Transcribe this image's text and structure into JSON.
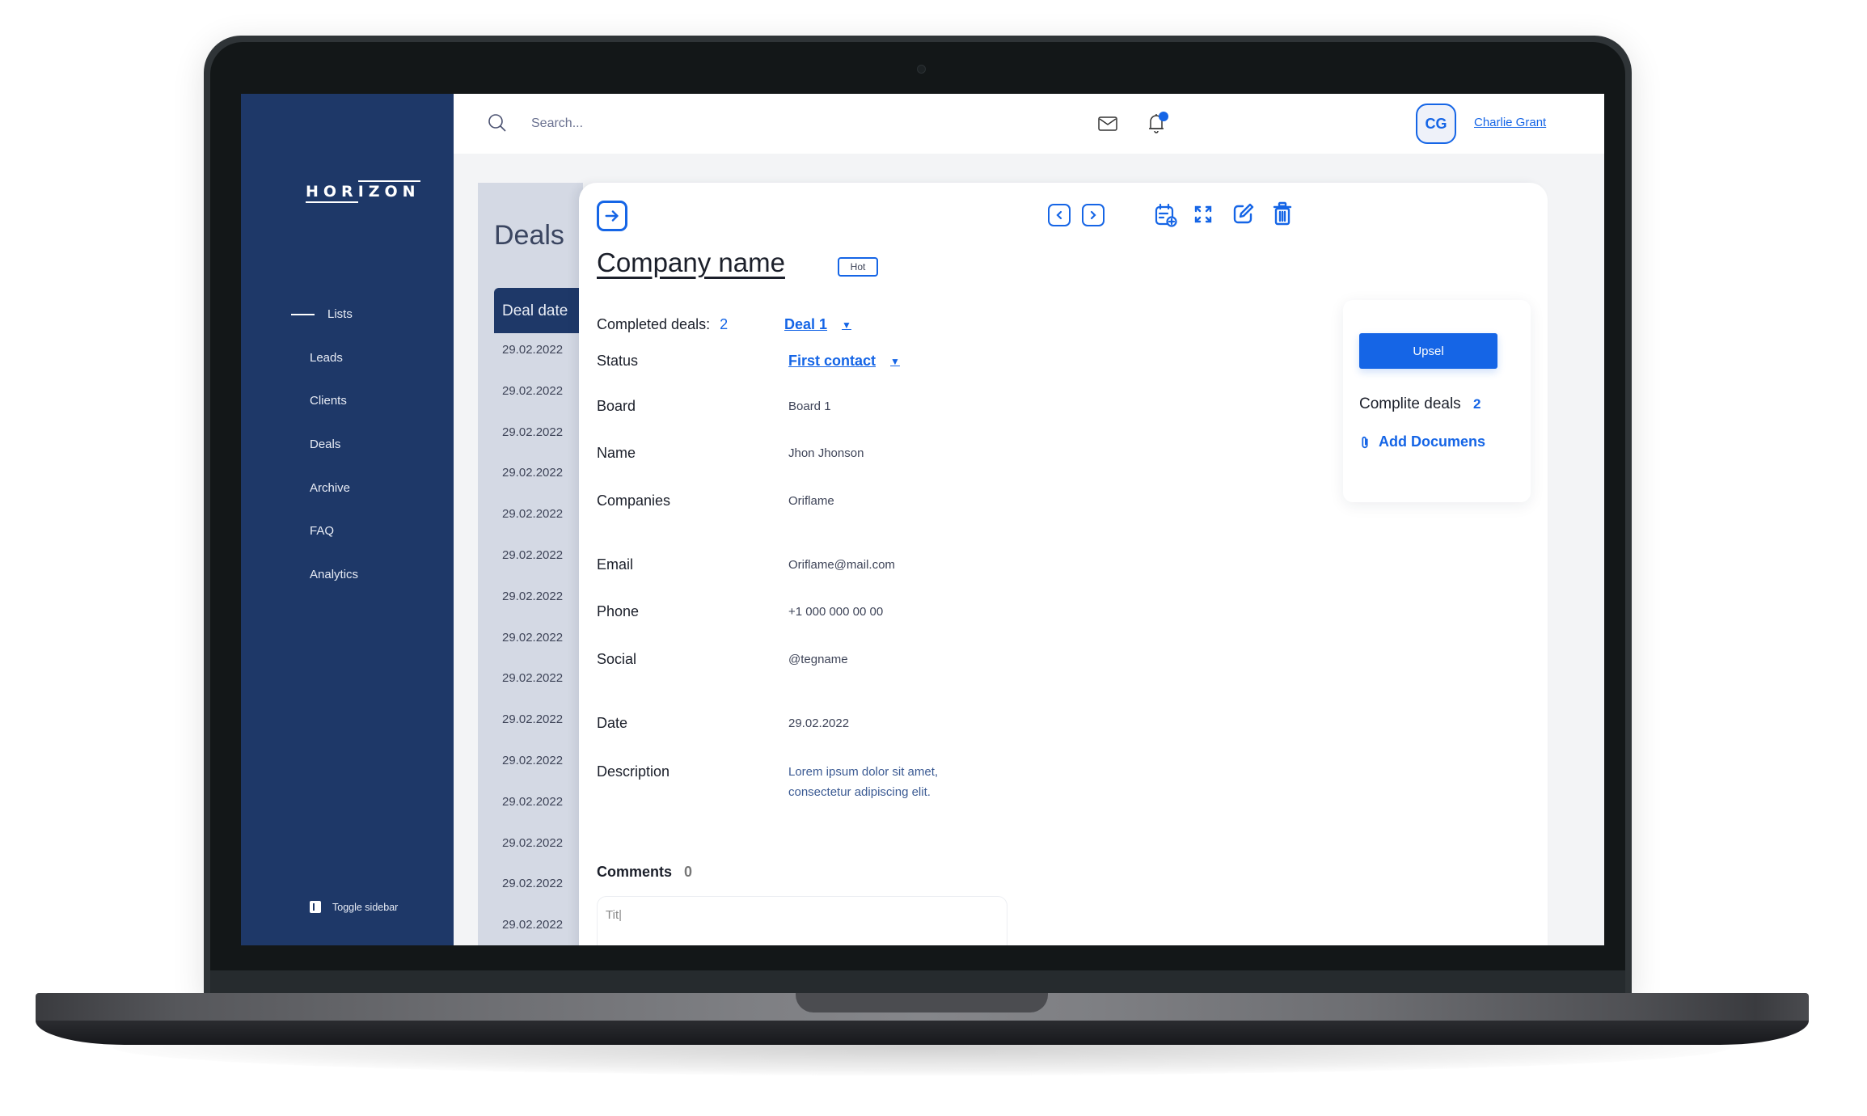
{
  "app": {
    "brand": {
      "logo_text": "HORIZON"
    },
    "colors": {
      "sidebar": "#1e3868",
      "accent": "#1565e6",
      "panel_bg": "#f3f4f6"
    }
  },
  "sidebar": {
    "items": [
      {
        "label": "Lists",
        "active": true
      },
      {
        "label": "Leads"
      },
      {
        "label": "Clients"
      },
      {
        "label": "Deals"
      },
      {
        "label": "Archive"
      },
      {
        "label": "FAQ"
      },
      {
        "label": "Analytics"
      }
    ],
    "toggle_label": "Toggle sidebar"
  },
  "header": {
    "search_placeholder": "Search...",
    "icons": [
      "search-icon",
      "mail-icon",
      "bell-icon"
    ],
    "notification_dot": true,
    "user": {
      "initials": "CG",
      "name": "Charlie Grant"
    }
  },
  "deals_list": {
    "title": "Deals",
    "column_header": "Deal date",
    "dates": [
      "29.02.2022",
      "29.02.2022",
      "29.02.2022",
      "29.02.2022",
      "29.02.2022",
      "29.02.2022",
      "29.02.2022",
      "29.02.2022",
      "29.02.2022",
      "29.02.2022",
      "29.02.2022",
      "29.02.2022",
      "29.02.2022",
      "29.02.2022",
      "29.02.2022"
    ]
  },
  "detail": {
    "company_name": "Company name",
    "badge": "Hot",
    "completed_deals_label": "Completed deals:",
    "completed_deals_count": "2",
    "deal_select": "Deal 1",
    "toolbar_icons": [
      "chevron-left-icon",
      "chevron-right-icon",
      "calendar-add-icon",
      "expand-icon",
      "edit-icon",
      "trash-icon"
    ],
    "fields": {
      "status": {
        "label": "Status",
        "value": "First contact"
      },
      "board": {
        "label": "Board",
        "value": "Board 1"
      },
      "name": {
        "label": "Name",
        "value": "Jhon Jhonson"
      },
      "companies": {
        "label": "Companies",
        "value": "Oriflame"
      },
      "email": {
        "label": "Email",
        "value": "Oriflame@mail.com"
      },
      "phone": {
        "label": "Phone",
        "value": "+1 000 000 00 00"
      },
      "social": {
        "label": "Social",
        "value": "@tegname"
      },
      "date": {
        "label": "Date",
        "value": "29.02.2022"
      },
      "description": {
        "label": "Description",
        "value_line1": "Lorem ipsum dolor sit amet,",
        "value_line2": "consectetur adipiscing elit."
      }
    },
    "comments": {
      "label": "Comments",
      "count": "0",
      "input_value": "Tit|"
    }
  },
  "side_card": {
    "upsel_label": "Upsel",
    "complite_label": "Complite deals",
    "complite_count": "2",
    "add_documents_label": "Add Documens"
  }
}
